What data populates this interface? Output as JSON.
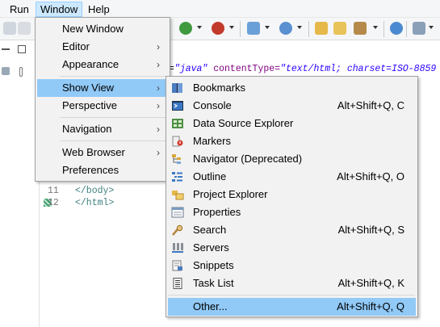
{
  "menubar": {
    "items": [
      "Run",
      "Window",
      "Help"
    ],
    "active": "Window"
  },
  "editor": {
    "code_line_fragment": [
      "=",
      "\"java\"",
      " contentType=",
      "\"text/html; charset=ISO-8859"
    ],
    "lines": [
      {
        "number": "11",
        "text": "</body>"
      },
      {
        "number": "12",
        "text": "</html>"
      }
    ]
  },
  "window_menu": {
    "items": [
      {
        "label": "New Window",
        "submenu": false
      },
      {
        "label": "Editor",
        "submenu": true
      },
      {
        "label": "Appearance",
        "submenu": true
      },
      {
        "label": "Show View",
        "submenu": true,
        "highlighted": true
      },
      {
        "label": "Perspective",
        "submenu": true
      },
      {
        "label": "Navigation",
        "submenu": true
      },
      {
        "label": "Web Browser",
        "submenu": true
      },
      {
        "label": "Preferences",
        "submenu": false
      }
    ]
  },
  "show_view_menu": {
    "items": [
      {
        "label": "Bookmarks",
        "shortcut": "",
        "icon": "bookmarks-icon"
      },
      {
        "label": "Console",
        "shortcut": "Alt+Shift+Q, C",
        "icon": "console-icon"
      },
      {
        "label": "Data Source Explorer",
        "shortcut": "",
        "icon": "data-source-icon"
      },
      {
        "label": "Markers",
        "shortcut": "",
        "icon": "markers-icon"
      },
      {
        "label": "Navigator (Deprecated)",
        "shortcut": "",
        "icon": "navigator-icon"
      },
      {
        "label": "Outline",
        "shortcut": "Alt+Shift+Q, O",
        "icon": "outline-icon"
      },
      {
        "label": "Project Explorer",
        "shortcut": "",
        "icon": "project-explorer-icon"
      },
      {
        "label": "Properties",
        "shortcut": "",
        "icon": "properties-icon"
      },
      {
        "label": "Search",
        "shortcut": "Alt+Shift+Q, S",
        "icon": "search-icon"
      },
      {
        "label": "Servers",
        "shortcut": "",
        "icon": "servers-icon"
      },
      {
        "label": "Snippets",
        "shortcut": "",
        "icon": "snippets-icon"
      },
      {
        "label": "Task List",
        "shortcut": "Alt+Shift+Q, K",
        "icon": "task-list-icon"
      },
      {
        "label": "Other...",
        "shortcut": "Alt+Shift+Q, Q",
        "icon": "",
        "highlighted": true
      }
    ]
  },
  "colors": {
    "menu_bg": "#f2f2f2",
    "highlight": "#91c9f7",
    "menubar_active": "#cce8ff",
    "code_string": "#2a00ff",
    "code_attr": "#7f007f",
    "code_tag": "#3f7f7f"
  }
}
